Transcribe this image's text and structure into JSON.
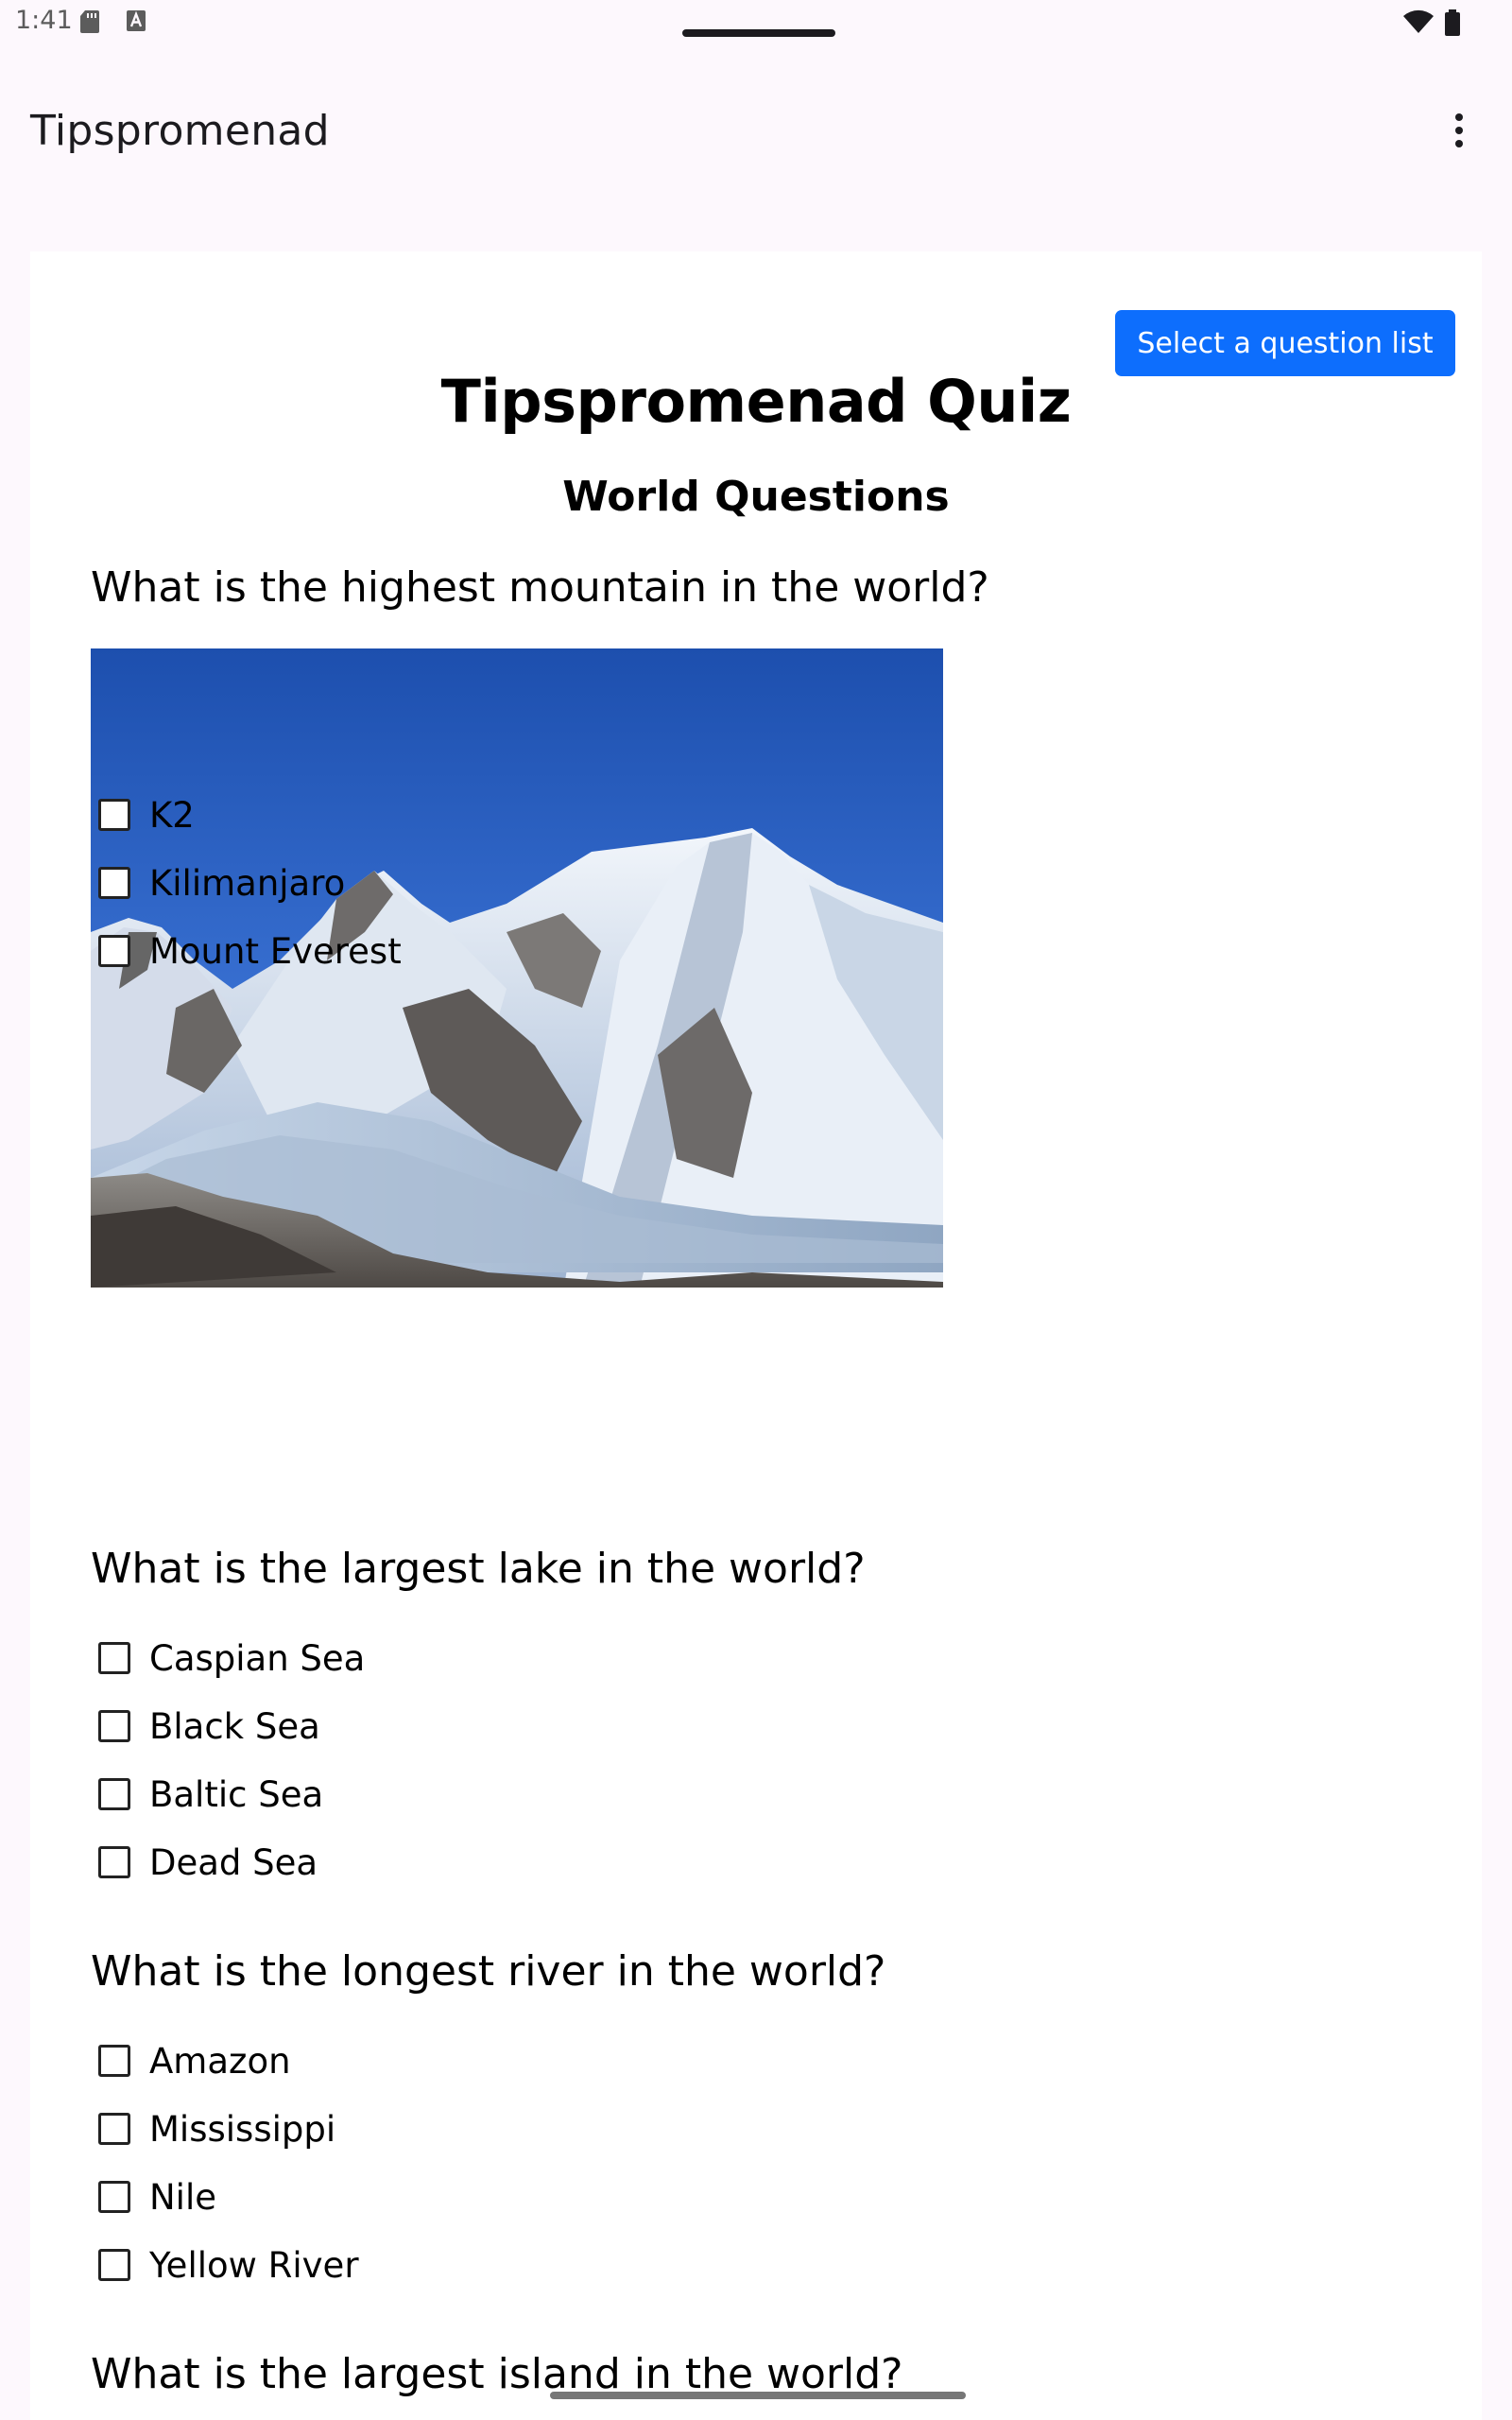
{
  "status_bar": {
    "time": "1:41",
    "icons": [
      "sd-card-icon",
      "keyboard-a-icon",
      "wifi-icon",
      "battery-icon"
    ]
  },
  "app_bar": {
    "title": "Tipspromenad",
    "menu_icon": "more-vert-icon"
  },
  "quiz": {
    "select_button": "Select a question list",
    "title": "Tipspromenad Quiz",
    "list_name": "World Questions",
    "questions": [
      {
        "text": "What is the highest mountain in the world?",
        "image": "mountain-photo",
        "options": [
          "K2",
          "Kilimanjaro",
          "Mount Everest"
        ]
      },
      {
        "text": "What is the largest lake in the world?",
        "options": [
          "Caspian Sea",
          "Black Sea",
          "Baltic Sea",
          "Dead Sea"
        ]
      },
      {
        "text": "What is the longest river in the world?",
        "options": [
          "Amazon",
          "Mississippi",
          "Nile",
          "Yellow River"
        ]
      },
      {
        "text": "What is the largest island in the world?"
      }
    ]
  },
  "colors": {
    "background": "#fdf8fd",
    "button": "#0d6efd",
    "card": "#ffffff"
  }
}
